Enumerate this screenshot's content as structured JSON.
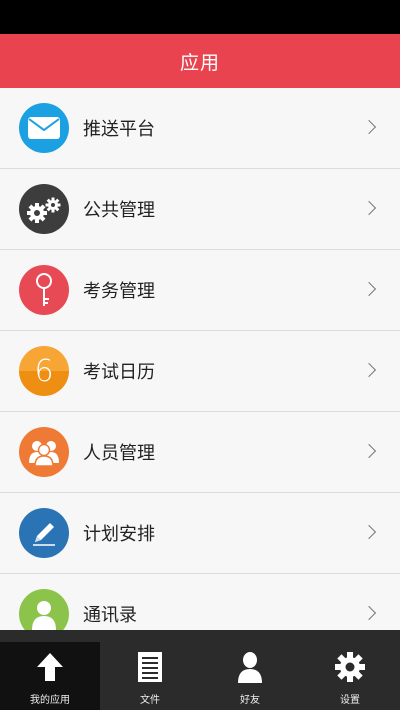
{
  "header": {
    "title": "应用"
  },
  "list": {
    "items": [
      {
        "label": "推送平台",
        "icon": "mail-icon",
        "color": "#1ba1e2"
      },
      {
        "label": "公共管理",
        "icon": "gears-icon",
        "color": "#3d3d3d"
      },
      {
        "label": "考务管理",
        "icon": "key-icon",
        "color": "#e84a55"
      },
      {
        "label": "考试日历",
        "icon": "calendar-six-icon",
        "color": "#f39c1f"
      },
      {
        "label": "人员管理",
        "icon": "people-icon",
        "color": "#ef7a35"
      },
      {
        "label": "计划安排",
        "icon": "pen-icon",
        "color": "#2a74b5"
      },
      {
        "label": "通讯录",
        "icon": "contact-icon",
        "color": "#8cc34b"
      }
    ],
    "calendar_number": "6"
  },
  "tabbar": {
    "tabs": [
      {
        "label": "我的应用",
        "icon": "up-arrow-icon",
        "active": true
      },
      {
        "label": "文件",
        "icon": "document-icon",
        "active": false
      },
      {
        "label": "好友",
        "icon": "person-icon",
        "active": false
      },
      {
        "label": "设置",
        "icon": "gear-icon",
        "active": false
      }
    ]
  }
}
